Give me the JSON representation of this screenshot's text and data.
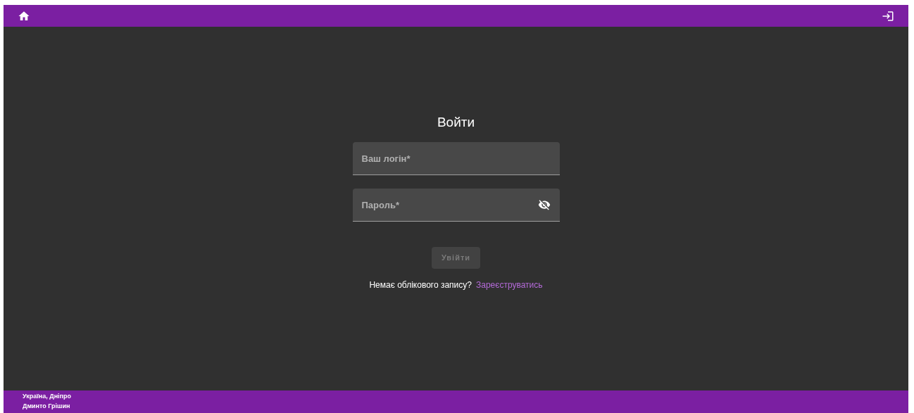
{
  "login": {
    "title": "Войти",
    "fields": [
      {
        "kind": "text",
        "placeholder": "Ваш логін*"
      },
      {
        "kind": "password",
        "placeholder": "Пароль*",
        "password_visible": false
      }
    ],
    "submit": {
      "label": "Увійти",
      "disabled": true
    },
    "register_prompt": "Немає облікового запису?",
    "register_link": "Зареєструватись"
  },
  "footer": {
    "lines": [
      "Україна, Дніпро",
      "Дминто Грішин"
    ]
  }
}
